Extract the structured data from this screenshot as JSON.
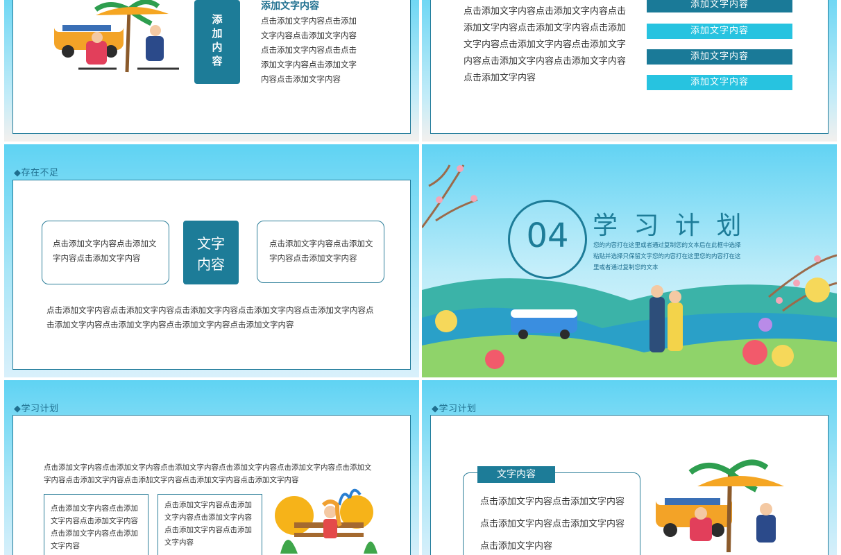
{
  "slide1": {
    "vertical_label": "添\n加\n内\n容",
    "heading": "添加文字内容",
    "body": "点击添加文字内容点击添加文字内容点击添加文字内容点击添加文字内容点击点击添加文字内容点击添加文字内容点击添加文字内容"
  },
  "slide2": {
    "body": "点击添加文字内容点击添加文字内容点击添加文字内容点击添加文字内容点击添加文字内容点击添加文字内容点击添加文字内容点击添加文字内容点击添加文字内容点击添加文字内容",
    "buttons": [
      "添加文字内容",
      "添加文字内容",
      "添加文字内容",
      "添加文字内容"
    ]
  },
  "slide3": {
    "section_title": "◆存在不足",
    "left_box": "点击添加文字内容点击添加文字内容点击添加文字内容",
    "center_label": "文字\n内容",
    "right_box": "点击添加文字内容点击添加文字内容点击添加文字内容",
    "bottom": "点击添加文字内容点击添加文字内容点击添加文字内容点击添加文字内容点击添加文字内容点击添加文字内容点击添加文字内容点击添加文字内容点击添加文字内容"
  },
  "slide4": {
    "number": "04",
    "title": "学 习 计 划",
    "subtitle": "您的内容打在这里或者通过复制您的文本后在此框中选择粘贴并选择只保留文字您的内容打在这里您的内容打在这里或者通过复制您的文本"
  },
  "slide5": {
    "section_title": "◆学习计划",
    "top_text": "点击添加文字内容点击添加文字内容点击添加文字内容点击添加文字内容点击添加文字内容点击添加文字内容点击添加文字内容点击添加文字内容点击添加文字内容点击添加文字内容",
    "box1": "点击添加文字内容点击添加文字内容点击添加文字内容点击添加文字内容点击添加文字内容",
    "box2": "点击添加文字内容点击添加文字内容点击添加文字内容点击添加文字内容点击添加文字内容"
  },
  "slide6": {
    "section_title": "◆学习计划",
    "label": "文字内容",
    "body": "点击添加文字内容点击添加文字内容点击添加文字内容点击添加文字内容点击添加文字内容"
  },
  "colors": {
    "primary": "#1d7c98",
    "accent": "#27c3e0",
    "sky": "#5fd3f3"
  }
}
